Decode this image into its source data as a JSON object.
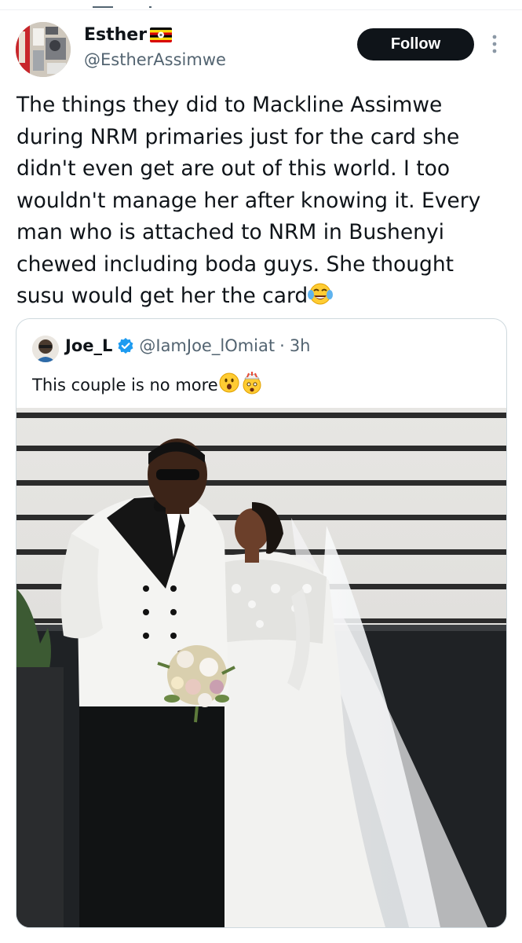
{
  "author": {
    "display_name": "Esther",
    "handle": "@EstherAssimwe",
    "flag": "uganda-flag-icon"
  },
  "follow_label": "Follow",
  "tweet_text": "The things they did to Mackline Assimwe during NRM primaries just for the card she didn't even get are out of this world. I too wouldn't manage her after knowing it. Every man who is attached to NRM in Bushenyi chewed including boda guys. She thought susu would get her the card",
  "tweet_emoji": "face-with-tears-of-joy-icon",
  "quoted": {
    "display_name": "Joe_L",
    "handle": "@IamJoe_lOmiat",
    "separator": "·",
    "time": "3h",
    "text": "This couple is no more",
    "emojis": [
      "hushed-face-icon",
      "exploding-head-icon"
    ]
  },
  "colors": {
    "text": "#0f1419",
    "secondary": "#536471",
    "follow_bg": "#0f1419",
    "verified": "#1d9bf0",
    "card_border": "#cfd9de"
  }
}
